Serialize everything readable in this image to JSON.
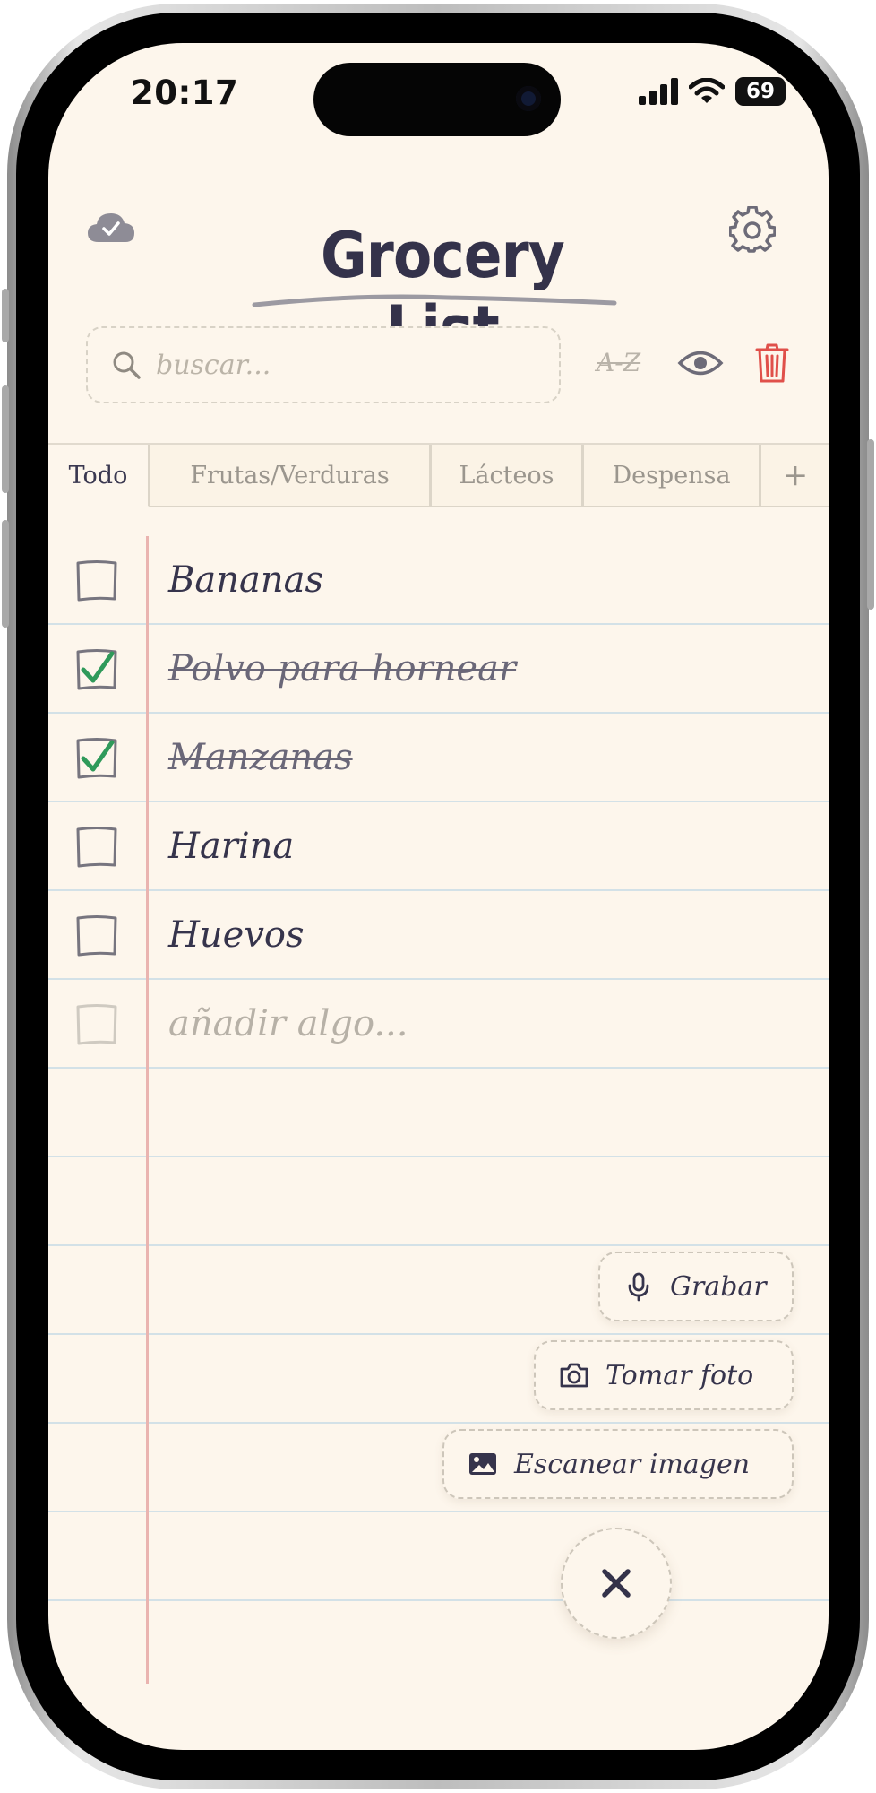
{
  "status_bar": {
    "time": "20:17",
    "battery": "69"
  },
  "header": {
    "title": "Grocery List"
  },
  "search": {
    "placeholder": "buscar..."
  },
  "toolbar": {
    "sort_label": "A-Z"
  },
  "tabs": [
    {
      "label": "Todo",
      "active": true
    },
    {
      "label": "Frutas/Verduras",
      "active": false
    },
    {
      "label": "Lácteos",
      "active": false
    },
    {
      "label": "Despensa",
      "active": false
    },
    {
      "label": "+",
      "active": false
    }
  ],
  "items": [
    {
      "label": "Bananas",
      "checked": false
    },
    {
      "label": "Polvo para hornear",
      "checked": true
    },
    {
      "label": "Manzanas",
      "checked": true
    },
    {
      "label": "Harina",
      "checked": false
    },
    {
      "label": "Huevos",
      "checked": false
    }
  ],
  "add_item": {
    "placeholder": "añadir algo..."
  },
  "actions": {
    "record": "Grabar",
    "photo": "Tomar foto",
    "scan": "Escanear imagen"
  },
  "colors": {
    "paper": "#fdf6ec",
    "ink": "#36344c",
    "check_green": "#2f9a5a",
    "margin_red": "#eab4b0",
    "rule_blue": "#d3e1e7",
    "delete_red": "#e0504a"
  },
  "icons": [
    "cloud-check-icon",
    "gear-icon",
    "search-icon",
    "eye-icon",
    "trash-icon",
    "checkbox-icon",
    "checkmark-icon",
    "microphone-icon",
    "camera-icon",
    "image-icon",
    "close-icon",
    "signal-icon",
    "wifi-icon",
    "battery-icon"
  ]
}
